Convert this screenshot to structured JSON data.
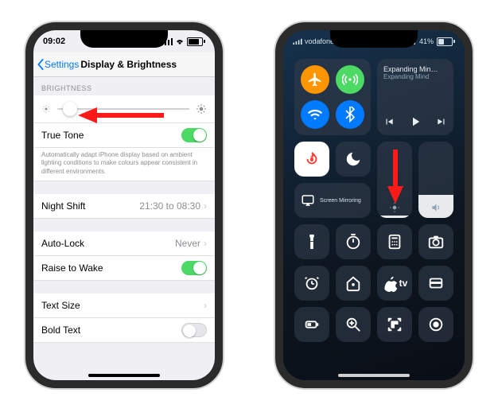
{
  "left_screen": {
    "status_time": "09:02",
    "back_label": "Settings",
    "title": "Display & Brightness",
    "sections": {
      "brightness_header": "BRIGHTNESS",
      "true_tone": {
        "label": "True Tone",
        "on": true
      },
      "true_tone_footnote": "Automatically adapt iPhone display based on ambient lighting conditions to make colours appear consistent in different environments.",
      "night_shift": {
        "label": "Night Shift",
        "value": "21:30 to 08:30"
      },
      "auto_lock": {
        "label": "Auto-Lock",
        "value": "Never"
      },
      "raise_to_wake": {
        "label": "Raise to Wake",
        "on": true
      },
      "text_size": {
        "label": "Text Size"
      },
      "bold_text": {
        "label": "Bold Text",
        "on": false
      }
    },
    "brightness_slider_value_pct": 4
  },
  "right_screen": {
    "status_carrier": "vodafone UK",
    "status_battery_pct": "41%",
    "music": {
      "title": "Expanding Min…",
      "subtitle": "Expanding Mind"
    },
    "mirror_label": "Screen Mirroring",
    "brightness_fill_pct": 3,
    "volume_fill_pct": 30,
    "apple_tv_label": "tv"
  }
}
